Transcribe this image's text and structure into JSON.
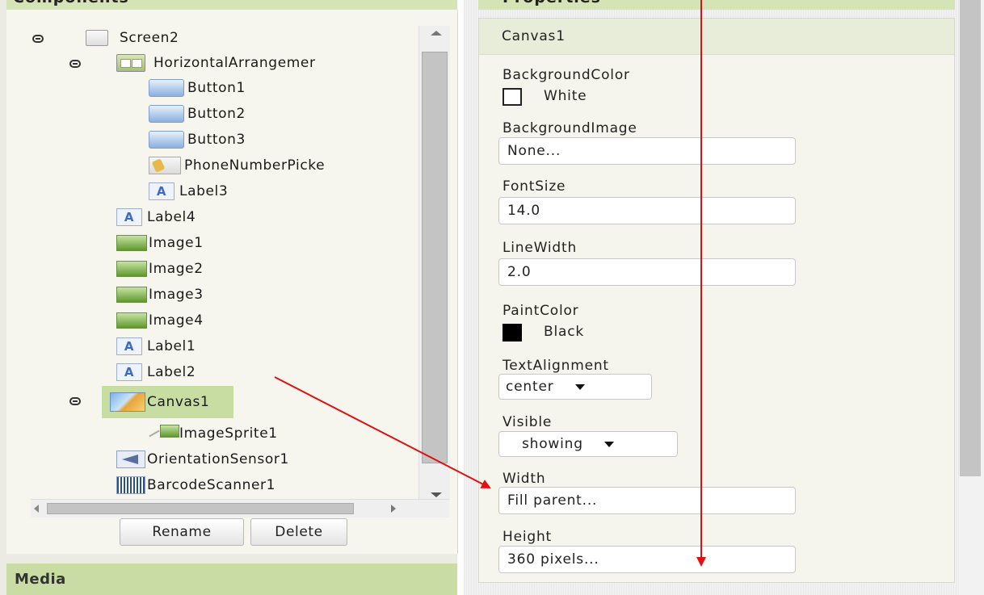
{
  "components": {
    "header": "Components",
    "tree": [
      {
        "label": "Screen2",
        "icon": "screen-icon",
        "toggle": true
      },
      {
        "label": "HorizontalArrangemer",
        "icon": "horizontal-arrangement-icon",
        "toggle": true
      },
      {
        "label": "Button1",
        "icon": "button-icon"
      },
      {
        "label": "Button2",
        "icon": "button-icon"
      },
      {
        "label": "Button3",
        "icon": "button-icon"
      },
      {
        "label": "PhoneNumberPicke",
        "icon": "phone-number-picker-icon"
      },
      {
        "label": "Label3",
        "icon": "label-icon"
      },
      {
        "label": "Label4",
        "icon": "label-icon"
      },
      {
        "label": "Image1",
        "icon": "image-icon"
      },
      {
        "label": "Image2",
        "icon": "image-icon"
      },
      {
        "label": "Image3",
        "icon": "image-icon"
      },
      {
        "label": "Image4",
        "icon": "image-icon"
      },
      {
        "label": "Label1",
        "icon": "label-icon"
      },
      {
        "label": "Label2",
        "icon": "label-icon"
      },
      {
        "label": "Canvas1",
        "icon": "canvas-icon",
        "toggle": true,
        "selected": true
      },
      {
        "label": "ImageSprite1",
        "icon": "image-sprite-icon"
      },
      {
        "label": "OrientationSensor1",
        "icon": "orientation-sensor-icon"
      },
      {
        "label": "BarcodeScanner1",
        "icon": "barcode-scanner-icon"
      }
    ],
    "rename_label": "Rename",
    "delete_label": "Delete"
  },
  "media": {
    "header": "Media"
  },
  "properties": {
    "header": "Properties",
    "component_name": "Canvas1",
    "background_color": {
      "label": "BackgroundColor",
      "value": "White",
      "swatch": "#ffffff"
    },
    "background_image": {
      "label": "BackgroundImage",
      "value": "None..."
    },
    "font_size": {
      "label": "FontSize",
      "value": "14.0"
    },
    "line_width": {
      "label": "LineWidth",
      "value": "2.0"
    },
    "paint_color": {
      "label": "PaintColor",
      "value": "Black",
      "swatch": "#000000"
    },
    "text_alignment": {
      "label": "TextAlignment",
      "value": "center"
    },
    "visible": {
      "label": "Visible",
      "value": "showing"
    },
    "width": {
      "label": "Width",
      "value": "Fill parent..."
    },
    "height": {
      "label": "Height",
      "value": "360 pixels..."
    }
  },
  "colors": {
    "panel_header_green": "#d4e4b5",
    "selected_row_green": "#c8dda2",
    "annotation_arrow_red": "#e01010"
  }
}
